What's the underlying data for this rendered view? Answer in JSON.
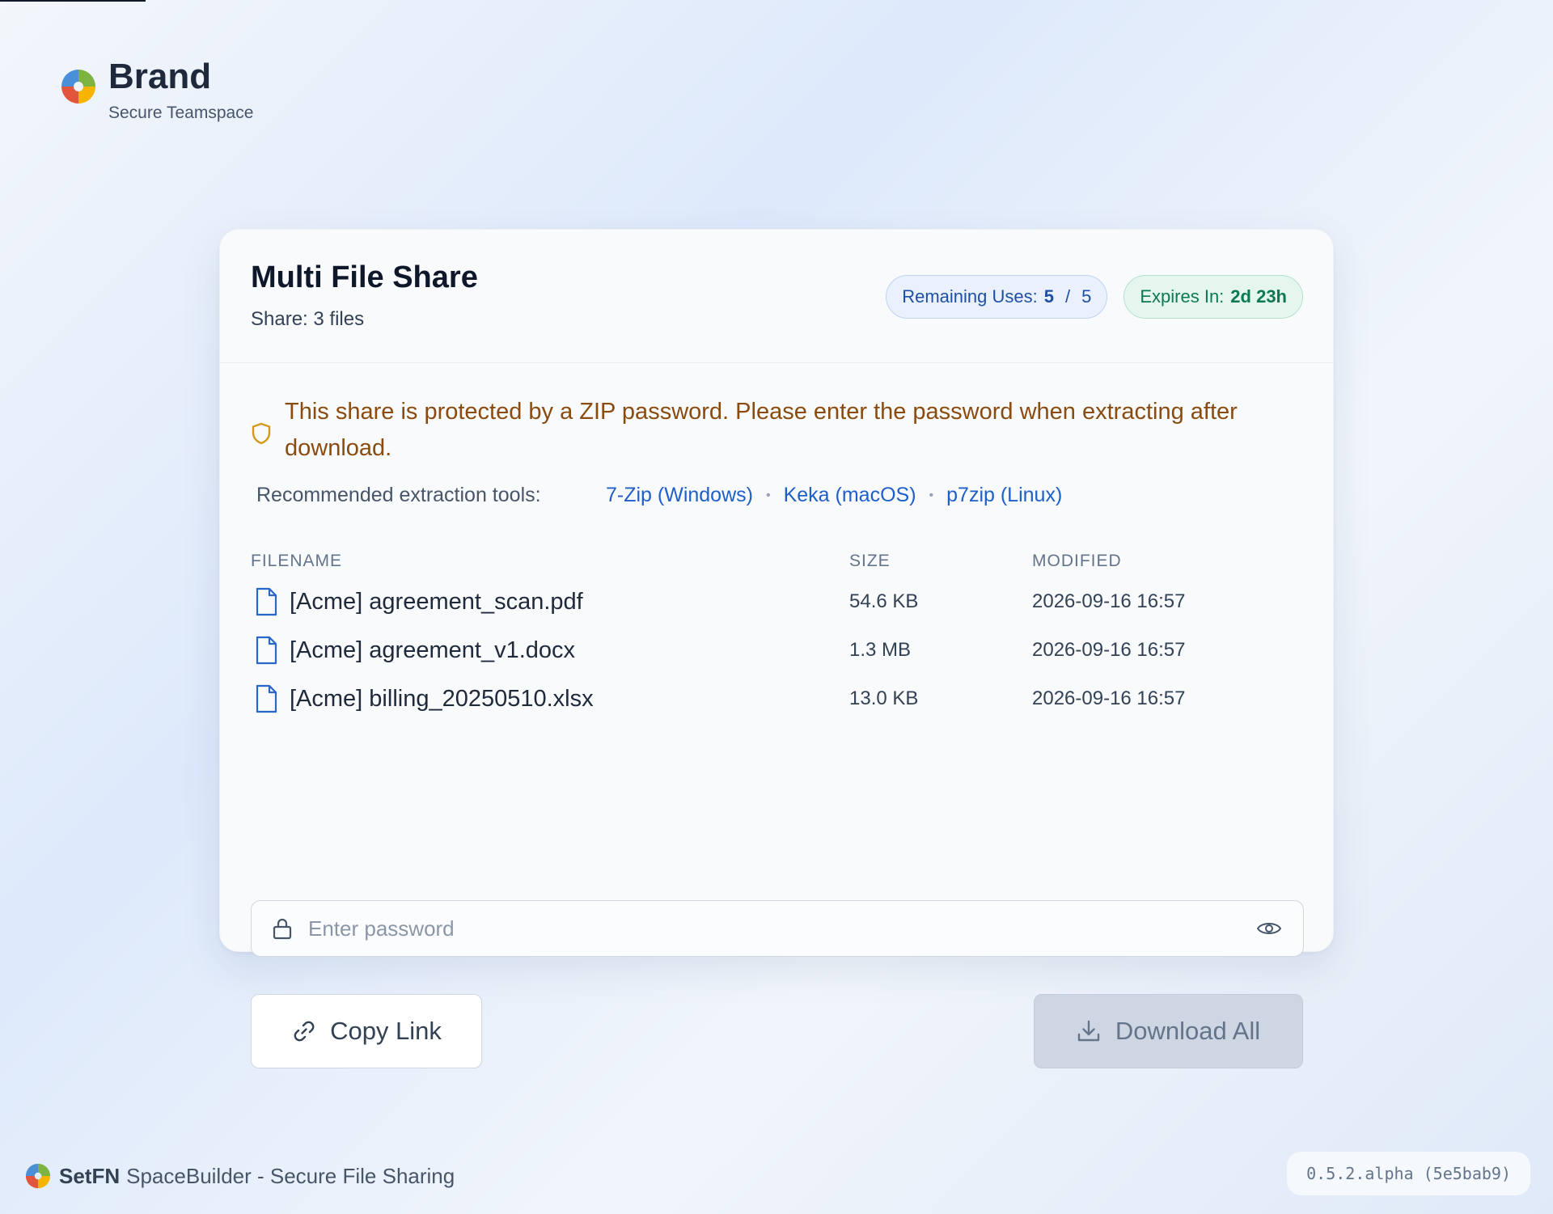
{
  "brand": {
    "name": "Brand",
    "subtitle": "Secure Teamspace",
    "logo_icon": "puzzle-logo-icon"
  },
  "share": {
    "title": "Multi File Share",
    "subtitle": "Share: 3 files",
    "remaining_label": "Remaining Uses:",
    "remaining_used": "5",
    "remaining_sep": "/",
    "remaining_total": "5",
    "expires_label": "Expires In:",
    "expires_value": "2d 23h"
  },
  "notice": {
    "text": "This share is protected by a ZIP password. Please enter the password when extracting after download.",
    "icon": "shield-icon"
  },
  "tools": {
    "label": "Recommended extraction tools:",
    "links": [
      "7-Zip (Windows)",
      "Keka (macOS)",
      "p7zip (Linux)"
    ],
    "separator": "•"
  },
  "files": {
    "headers": {
      "name": "FILENAME",
      "size": "SIZE",
      "modified": "MODIFIED"
    },
    "rows": [
      {
        "name": "[Acme] agreement_scan.pdf",
        "size": "54.6 KB",
        "modified": "2026-09-16 16:57"
      },
      {
        "name": "[Acme] agreement_v1.docx",
        "size": "1.3 MB",
        "modified": "2026-09-16 16:57"
      },
      {
        "name": "[Acme] billing_20250510.xlsx",
        "size": "13.0 KB",
        "modified": "2026-09-16 16:57"
      }
    ]
  },
  "password": {
    "placeholder": "Enter password",
    "value": ""
  },
  "actions": {
    "copy_label": "Copy Link",
    "download_label": "Download All"
  },
  "footer": {
    "brand_bold": "SetFN",
    "text": "SpaceBuilder - Secure File Sharing",
    "version": "0.5.2.alpha (5e5bab9)"
  },
  "colors": {
    "accent": "#1e5fc9",
    "warning": "#8a4b0f",
    "success": "#0b7a52",
    "disabled": "#cdd6e2"
  }
}
